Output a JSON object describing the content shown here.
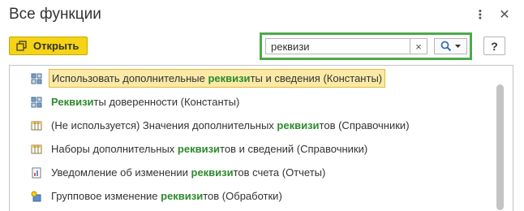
{
  "window": {
    "title": "Все функции"
  },
  "toolbar": {
    "open_label": "Открыть",
    "help_label": "?"
  },
  "search": {
    "value": "реквизи",
    "clear_label": "×"
  },
  "list": {
    "items": [
      {
        "icon": "constant-icon",
        "before": "Использовать дополнительные ",
        "match": "реквизи",
        "after": "ты и сведения (Константы)",
        "selected": true
      },
      {
        "icon": "constant-icon",
        "before": "",
        "match": "Реквизи",
        "after": "ты доверенности (Константы)",
        "selected": false
      },
      {
        "icon": "catalog-icon",
        "before": "(Не используется) Значения дополнительных ",
        "match": "реквизи",
        "after": "тов (Справочники)",
        "selected": false
      },
      {
        "icon": "catalog-icon",
        "before": "Наборы дополнительных ",
        "match": "реквизи",
        "after": "тов и сведений (Справочники)",
        "selected": false
      },
      {
        "icon": "report-icon",
        "before": "Уведомление об изменении ",
        "match": "реквизи",
        "after": "тов счета (Отчеты)",
        "selected": false
      },
      {
        "icon": "processing-icon",
        "before": "Групповое изменение ",
        "match": "реквизи",
        "after": "тов (Обработки)",
        "selected": false
      }
    ]
  },
  "colors": {
    "accent_yellow": "#f5d315",
    "search_border": "#4caa4a",
    "highlight": "#2e8b2e",
    "selection": "#fbe9a6"
  }
}
